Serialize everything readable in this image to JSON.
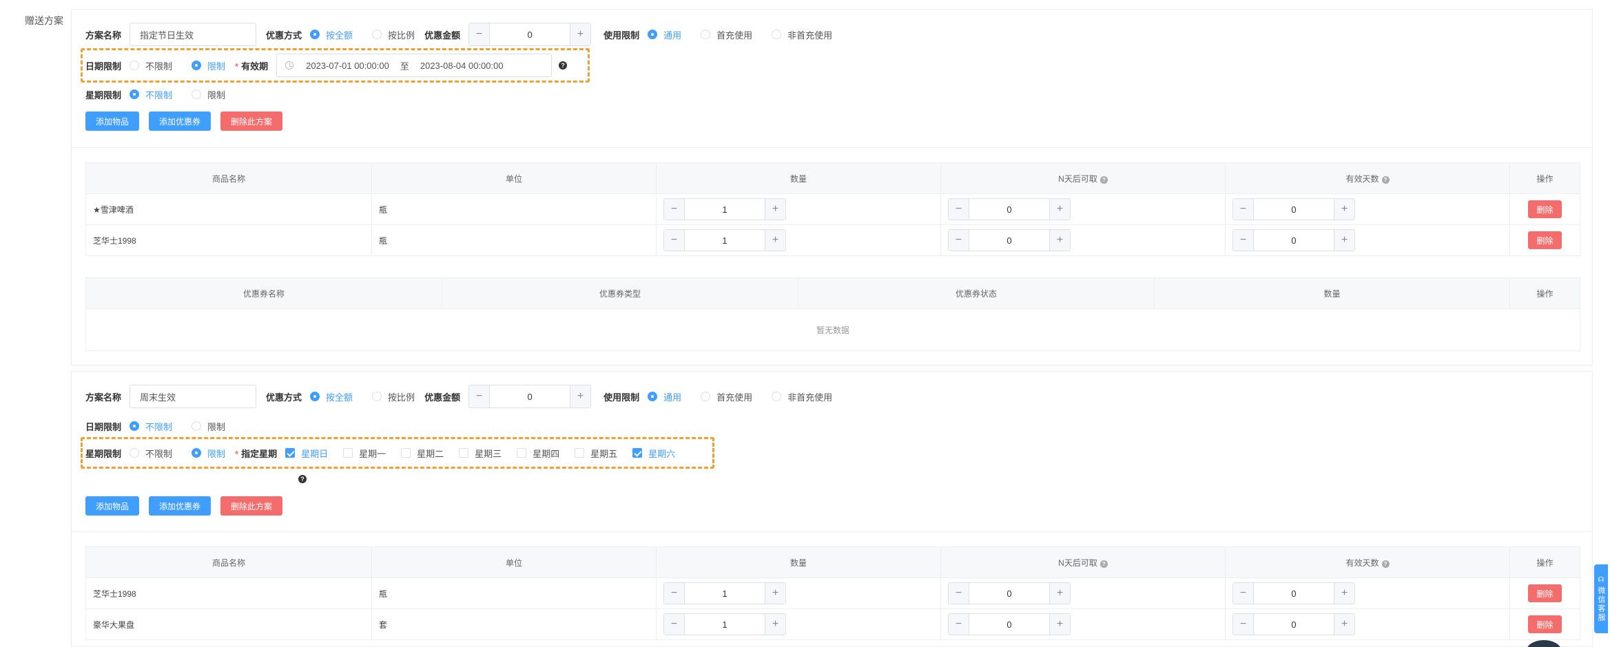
{
  "side_label": "赠送方案",
  "labels": {
    "plan_name": "方案名称",
    "discount_mode": "优惠方式",
    "discount_amount": "优惠金额",
    "usage_limit": "使用限制",
    "date_limit": "日期限制",
    "week_limit": "星期限制",
    "valid_period": "有效期",
    "designated_week": "指定星期",
    "range_sep": "至"
  },
  "options": {
    "by_amount": "按全额",
    "by_ratio": "按比例",
    "general": "通用",
    "first_recharge": "首充使用",
    "non_first_recharge": "非首充使用",
    "unlimited": "不限制",
    "limited": "限制"
  },
  "buttons": {
    "add_item": "添加物品",
    "add_coupon": "添加优惠券",
    "delete_plan": "删除此方案",
    "delete": "删除"
  },
  "items_headers": [
    "商品名称",
    "单位",
    "数量",
    "N天后可取",
    "有效天数",
    "操作"
  ],
  "coupon_headers": [
    "优惠券名称",
    "优惠券类型",
    "优惠券状态",
    "数量",
    "操作"
  ],
  "empty_text": "暂无数据",
  "weekdays": [
    "星期日",
    "星期一",
    "星期二",
    "星期三",
    "星期四",
    "星期五",
    "星期六"
  ],
  "plan1": {
    "name": "指定节日生效",
    "discount_amount": "0",
    "date_start": "2023-07-01 00:00:00",
    "date_end": "2023-08-04 00:00:00",
    "items": [
      {
        "name": "★雪津啤酒",
        "unit": "瓶",
        "qty": "1",
        "n_days": "0",
        "valid_days": "0"
      },
      {
        "name": "芝华士1998",
        "unit": "瓶",
        "qty": "1",
        "n_days": "0",
        "valid_days": "0"
      }
    ]
  },
  "plan2": {
    "name": "周末生效",
    "discount_amount": "0",
    "checked_days": [
      true,
      false,
      false,
      false,
      false,
      false,
      true
    ],
    "items": [
      {
        "name": "芝华士1998",
        "unit": "瓶",
        "qty": "1",
        "n_days": "0",
        "valid_days": "0"
      },
      {
        "name": "豪华大果盘",
        "unit": "套",
        "qty": "1",
        "n_days": "0",
        "valid_days": "0"
      }
    ]
  },
  "float_service": "微信客服",
  "colors": {
    "primary": "#409eff",
    "danger": "#f56c6c",
    "highlight": "#f0a030"
  }
}
